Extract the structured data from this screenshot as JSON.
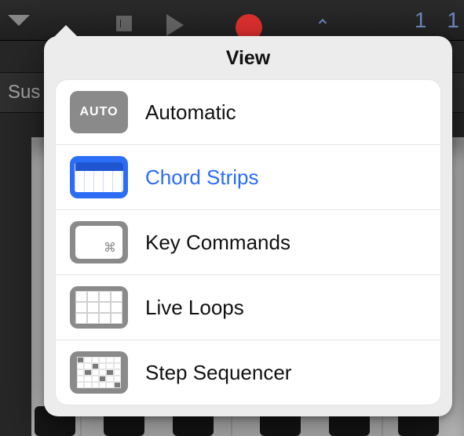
{
  "toolbar": {
    "counter_left": "1",
    "counter_right": "1"
  },
  "strip2": {
    "label": "Sus"
  },
  "popover": {
    "title": "View",
    "items": [
      {
        "icon": "auto-icon",
        "label": "Automatic",
        "selected": false,
        "badge": "AUTO"
      },
      {
        "icon": "chord-strips-icon",
        "label": "Chord Strips",
        "selected": true
      },
      {
        "icon": "key-commands-icon",
        "label": "Key Commands",
        "selected": false
      },
      {
        "icon": "live-loops-icon",
        "label": "Live Loops",
        "selected": false
      },
      {
        "icon": "step-sequencer-icon",
        "label": "Step Sequencer",
        "selected": false
      }
    ]
  }
}
